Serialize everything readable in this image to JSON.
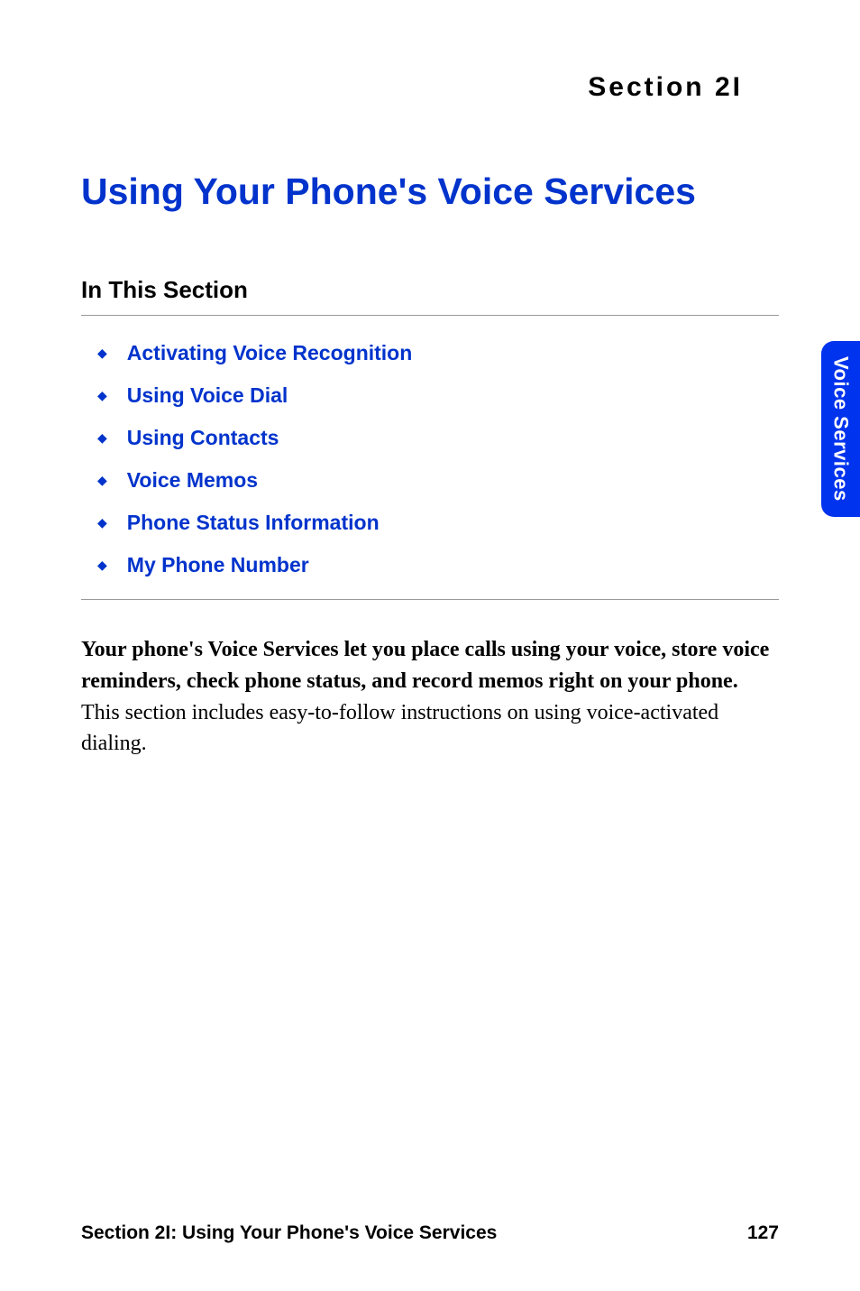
{
  "section_label": "Section 2I",
  "main_title": "Using Your Phone's Voice Services",
  "subsection_heading": "In This Section",
  "toc_items": [
    "Activating Voice Recognition",
    "Using Voice Dial",
    "Using Contacts",
    "Voice Memos",
    "Phone Status Information",
    "My Phone Number"
  ],
  "body_bold": "Your phone's Voice Services let you place calls using your voice, store voice reminders, check phone status, and record memos right on your phone.",
  "body_regular": " This section includes easy-to-follow instructions on using voice-activated dialing.",
  "side_tab": "Voice Services",
  "footer_left": "Section 2I: Using Your Phone's Voice Services",
  "footer_right": "127"
}
